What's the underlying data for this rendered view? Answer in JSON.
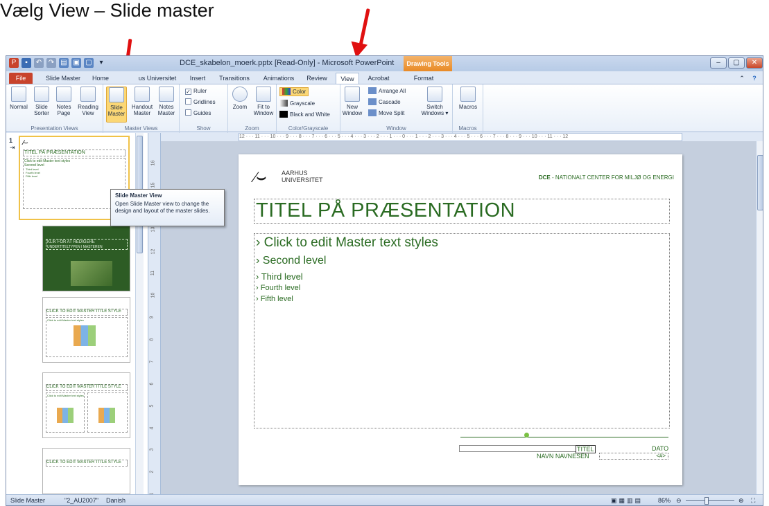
{
  "heading": "Vælg View – Slide master",
  "window": {
    "title": "DCE_skabelon_moerk.pptx [Read-Only] - Microsoft PowerPoint",
    "context_tab": "Drawing Tools",
    "app_icon": "P"
  },
  "tabs": [
    "File",
    "Slide Master",
    "Home",
    "us Universitet",
    "Insert",
    "Transitions",
    "Animations",
    "Review",
    "View",
    "Acrobat",
    "Format"
  ],
  "active_tab": "View",
  "ribbon": {
    "presentation_views": {
      "label": "Presentation Views",
      "buttons": [
        {
          "line1": "Normal",
          "line2": ""
        },
        {
          "line1": "Slide",
          "line2": "Sorter"
        },
        {
          "line1": "Notes",
          "line2": "Page"
        },
        {
          "line1": "Reading",
          "line2": "View"
        }
      ]
    },
    "master_views": {
      "label": "Master Views",
      "buttons": [
        {
          "line1": "Slide",
          "line2": "Master"
        },
        {
          "line1": "Handout",
          "line2": "Master"
        },
        {
          "line1": "Notes",
          "line2": "Master"
        }
      ]
    },
    "show": {
      "label": "Show",
      "items": [
        {
          "label": "Ruler",
          "checked": true
        },
        {
          "label": "Gridlines",
          "checked": false
        },
        {
          "label": "Guides",
          "checked": false
        }
      ]
    },
    "zoom": {
      "label": "Zoom",
      "buttons": [
        {
          "line1": "Zoom",
          "line2": ""
        },
        {
          "line1": "Fit to",
          "line2": "Window"
        }
      ]
    },
    "color": {
      "label": "Color/Grayscale",
      "items": [
        "Color",
        "Grayscale",
        "Black and White"
      ]
    },
    "window_grp": {
      "label": "Window",
      "new_window": {
        "line1": "New",
        "line2": "Window"
      },
      "items": [
        "Arrange All",
        "Cascade",
        "Move Split"
      ],
      "switch": {
        "line1": "Switch",
        "line2": "Windows"
      }
    },
    "macros": {
      "label": "Macros",
      "button": "Macros"
    }
  },
  "tooltip": {
    "title": "Slide Master View",
    "body": "Open Slide Master view to change the design and layout of the master slides."
  },
  "thumbnails": [
    {
      "num": "1",
      "title": "TITEL PÅ PRÆSENTATION",
      "lines": [
        "Click to edit Master text styles",
        "Second level",
        "Third level",
        "Fourth level",
        "Fifth level"
      ]
    },
    {
      "num": "",
      "title": "KLIK FOR AT REDIGERE",
      "lines": [
        "UNDERTITELTYPEN I MASTEREN"
      ]
    },
    {
      "num": "",
      "title": "CLICK TO EDIT MASTER TITLE STYLE",
      "lines": [
        "Click to edit Master text styles",
        "Second level",
        "Third level",
        "Fourth level",
        "Fifth level"
      ]
    },
    {
      "num": "",
      "title": "CLICK TO EDIT MASTER TITLE STYLE",
      "lines": [
        "Click to edit Master text styles",
        "Second level",
        "Third level",
        "Fourth level"
      ]
    },
    {
      "num": "",
      "title": "CLICK TO EDIT MASTER TITLE STYLE",
      "lines": []
    }
  ],
  "ruler": {
    "h": "12 · · · 11 · · · 10 · · · 9 · · · 8 · · · 7 · · · 6 · · · 5 · · · 4 · · · 3 · · · 2 · · · 1 · · · 0 · · · 1 · · · 2 · · · 3 · · · 4 · · · 5 · · · 6 · · · 7 · · · 8 · · · 9 · · · 10 · · · 11 · · · 12",
    "v": [
      "16",
      "15",
      "14",
      "13",
      "12",
      "11",
      "10",
      "9",
      "8",
      "7",
      "6",
      "5",
      "4",
      "3",
      "2",
      "1"
    ]
  },
  "slide": {
    "logo_line1": "AARHUS",
    "logo_line2": "UNIVERSITET",
    "header_right_bold": "DCE",
    "header_right": " - NATIONALT CENTER FOR MILJØ OG ENERGI",
    "title": "TITEL PÅ PRÆSENTATION",
    "levels": [
      "Click to edit Master text styles",
      "Second level",
      "Third level",
      "Fourth level",
      "Fifth level"
    ],
    "footer_title": "TITEL",
    "footer_name": "NAVN NAVNESEN",
    "footer_date": "DATO",
    "footer_num": "<#>"
  },
  "status": {
    "view": "Slide Master",
    "theme": "\"2_AU2007\"",
    "language": "Danish",
    "zoom": "86%"
  },
  "colors": {
    "accent_green": "#2a6b22",
    "arrow_red": "#e01010",
    "file_tab": "#c8432c",
    "highlight": "#fbd775"
  }
}
